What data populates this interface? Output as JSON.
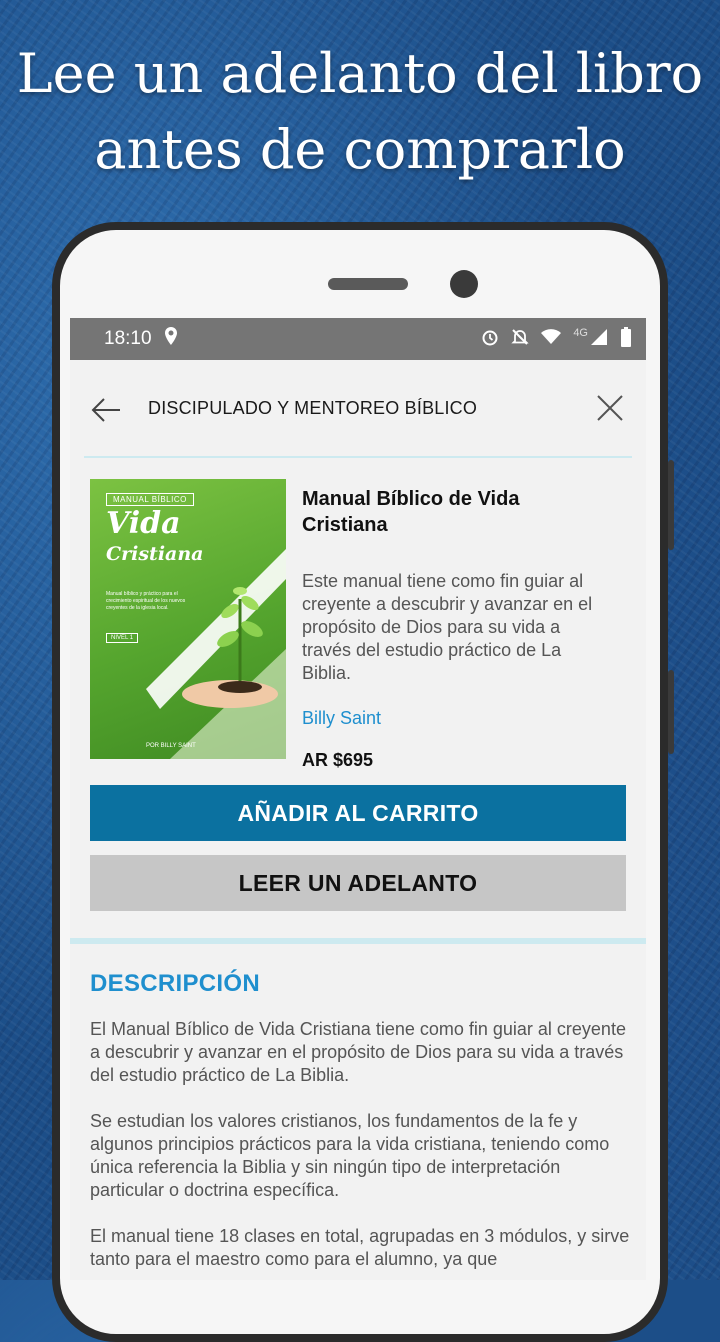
{
  "headline": {
    "line1": "Lee un adelanto del libro",
    "line2": "antes de comprarlo"
  },
  "status_bar": {
    "time": "18:10",
    "network": "4G",
    "icons": [
      "location-icon",
      "alarm-icon",
      "notifications-off-icon",
      "wifi-icon",
      "signal-icon",
      "battery-icon"
    ]
  },
  "toolbar": {
    "title": "DISCIPULADO Y MENTOREO BÍBLICO"
  },
  "book": {
    "title": "Manual Bíblico de Vida Cristiana",
    "summary": "Este manual tiene como fin guiar al creyente a descubrir y avanzar en el propósito de Dios para su vida a través del estudio práctico de La Biblia.",
    "author": "Billy Saint",
    "price": "AR $695",
    "cover": {
      "tag": "MANUAL BÍBLICO",
      "title1": "Vida",
      "title2": "Cristiana",
      "subtitle": "Manual bíblico y práctico para el crecimiento espiritual de los nuevos creyentes de la iglesia local.",
      "level": "NIVEL 1",
      "author": "POR BILLY SAINT"
    }
  },
  "actions": {
    "add_to_cart": "AÑADIR AL CARRITO",
    "read_preview": "LEER UN ADELANTO"
  },
  "description": {
    "heading": "DESCRIPCIÓN",
    "paragraphs": [
      "El Manual Bíblico de Vida Cristiana tiene como fin guiar al creyente a descubrir y avanzar en el propósito de Dios para su vida a través del estudio práctico de La Biblia.",
      "Se estudian los valores cristianos, los fundamentos de la fe y algunos principios prácticos para la vida cristiana, teniendo como única referencia la Biblia y sin ningún tipo de interpretación particular o doctrina específica.",
      "El manual tiene 18 clases en total, agrupadas en 3 módulos, y sirve tanto para el maestro como para el alumno, ya que"
    ]
  },
  "colors": {
    "accent": "#1f8fce",
    "primary_button": "#0b71a0",
    "secondary_button": "#c6c6c6",
    "divider": "#cdeaf0"
  }
}
